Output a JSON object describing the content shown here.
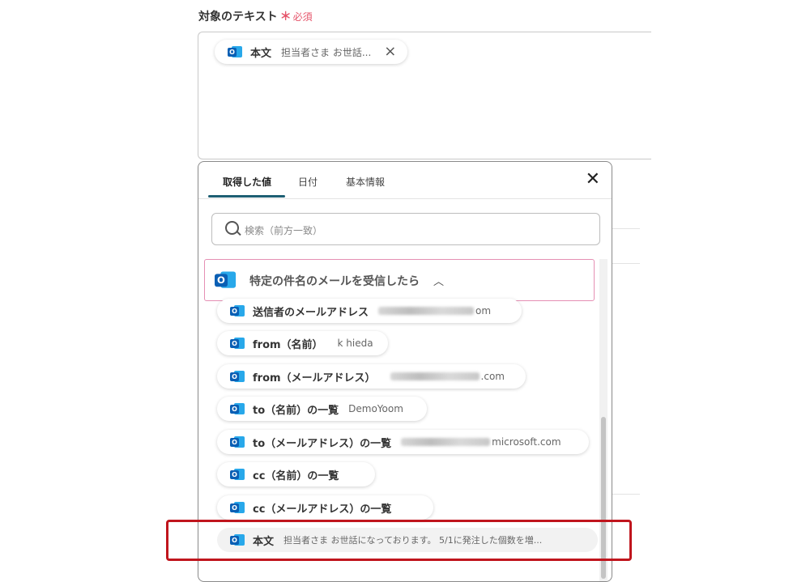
{
  "field": {
    "label": "対象のテキスト",
    "asterisk": "＊",
    "required": "必須",
    "chip": {
      "label": "本文",
      "value": "担当者さま お世話...",
      "close_icon": "×"
    }
  },
  "panel": {
    "tabs": [
      "取得した値",
      "日付",
      "基本情報"
    ],
    "active_tab": 0,
    "close_icon": "✕",
    "search_placeholder": "検索（前方一致）",
    "group_title": "特定の件名のメールを受信したら",
    "group_chevron": "︿",
    "items": [
      {
        "label": "送信者のメールアドレス",
        "value": "",
        "value_suffix": "om",
        "blurred": true
      },
      {
        "label": "from（名前）",
        "value": "k hieda",
        "value_suffix": "",
        "blurred": false
      },
      {
        "label": "from（メールアドレス）",
        "value": "",
        "value_suffix": ".com",
        "blurred": true
      },
      {
        "label": "to（名前）の一覧",
        "value": "DemoYoom",
        "value_suffix": "",
        "blurred": false
      },
      {
        "label": "to（メールアドレス）の一覧",
        "value": "",
        "value_suffix": "microsoft.com",
        "blurred": true
      },
      {
        "label": "cc（名前）の一覧",
        "value": "",
        "value_suffix": "",
        "blurred": false
      },
      {
        "label": "cc（メールアドレス）の一覧",
        "value": "",
        "value_suffix": "",
        "blurred": false
      },
      {
        "label": "本文",
        "value": "担当者さま お世話になっております。 5/1に発注した個数を増...",
        "value_suffix": "",
        "blurred": false
      }
    ]
  },
  "colors": {
    "accent": "#1d5f73",
    "highlight": "#c0151d",
    "required": "#e5546a",
    "group_border": "#e58fb4"
  }
}
